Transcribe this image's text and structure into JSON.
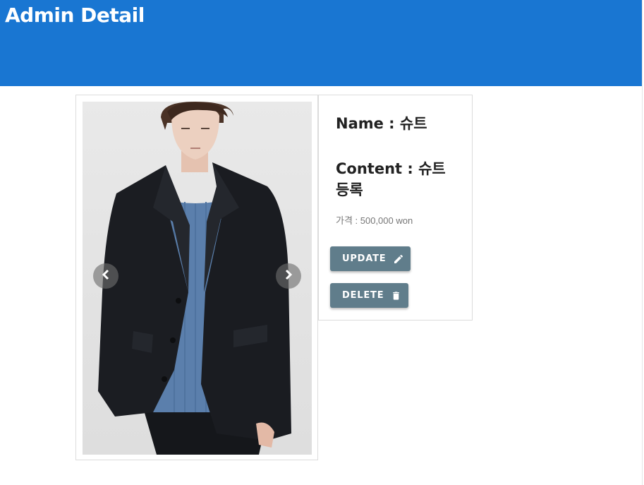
{
  "header": {
    "title": "Admin Detail",
    "color": "#1976d2"
  },
  "carousel": {
    "image_alt": "Model wearing a dark suit jacket over a blue knit sweater",
    "prev_icon": "chevron-left-icon",
    "next_icon": "chevron-right-icon"
  },
  "product": {
    "name_text": "Name : 슈트",
    "content_text": "Content : 슈트 등록",
    "price_text": "가격 : 500,000 won"
  },
  "actions": {
    "update_label": "UPDATE",
    "update_icon": "pencil-icon",
    "delete_label": "DELETE",
    "delete_icon": "trash-icon",
    "button_color": "#607d8b"
  }
}
